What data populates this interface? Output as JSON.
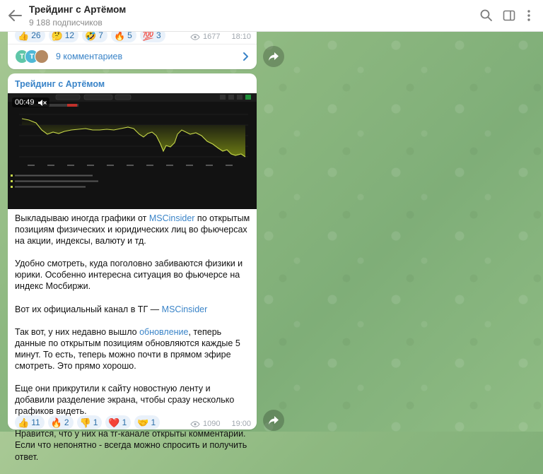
{
  "header": {
    "title": "Трейдинг с Артёмом",
    "subtitle": "9 188 подписчиков"
  },
  "post1": {
    "reactions": [
      {
        "emoji": "👍",
        "count": "26"
      },
      {
        "emoji": "🤔",
        "count": "12"
      },
      {
        "emoji": "🤣",
        "count": "7"
      },
      {
        "emoji": "🔥",
        "count": "5"
      },
      {
        "emoji": "💯",
        "count": "3"
      }
    ],
    "views": "1677",
    "time": "18:10",
    "comments": {
      "avatars": [
        {
          "letter": "T",
          "color": "#5fc6a8"
        },
        {
          "letter": "T",
          "color": "#4fb8d6"
        },
        {
          "letter": "",
          "color": "#b58a62"
        }
      ],
      "label": "9 комментариев"
    }
  },
  "post2": {
    "channel": "Трейдинг с Артёмом",
    "video_time": "00:49",
    "paragraphs": [
      [
        {
          "t": "Выкладываю иногда графики от "
        },
        {
          "t": "MSCinsider",
          "link": true
        },
        {
          "t": " по открытым позициям физических и юридических лиц во фьючерсах на акции, индексы, валюту и тд."
        }
      ],
      [
        {
          "t": "Удобно смотреть, куда поголовно забиваются физики и юрики. Особенно интересна ситуация во фьючерсе на индекс Мосбиржи."
        }
      ],
      [
        {
          "t": "Вот их официальный канал в ТГ — "
        },
        {
          "t": "MSCinsider",
          "link": true
        }
      ],
      [
        {
          "t": "Так вот, у них недавно вышло "
        },
        {
          "t": "обновление",
          "link": true
        },
        {
          "t": ", теперь данные по открытым позициям обновляются каждые 5 минут. То есть, теперь можно почти в прямом эфире смотреть. Это прямо хорошо."
        }
      ],
      [
        {
          "t": "Еще они прикрутили к сайту новостную ленту и добавили разделение экрана, чтобы сразу несколько графиков видеть."
        }
      ],
      [
        {
          "t": "Нравится, что у них на тг-канале открыты комментарии. Если что непонятно - всегда можно спросить и получить ответ."
        }
      ]
    ],
    "reactions": [
      {
        "emoji": "👍",
        "count": "11"
      },
      {
        "emoji": "🔥",
        "count": "2"
      },
      {
        "emoji": "👎",
        "count": "1"
      },
      {
        "emoji": "❤️",
        "count": "1"
      },
      {
        "emoji": "🤝",
        "count": "1"
      }
    ],
    "views": "1090",
    "time": "19:00"
  },
  "colors": {
    "accent": "#3a84c8",
    "chart_line": "#c8d94a",
    "chart_fill": "#5e6b12",
    "background_top": "#a9c995",
    "background_bottom": "#7fae78"
  }
}
